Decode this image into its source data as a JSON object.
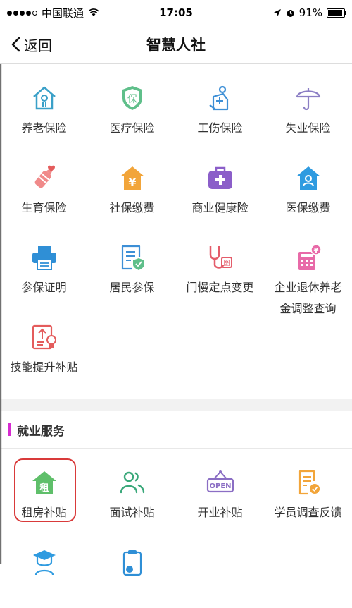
{
  "status_bar": {
    "carrier": "中国联通",
    "time": "17:05",
    "battery": "91%",
    "battery_level": 0.91
  },
  "nav": {
    "back_label": "返回",
    "title": "智慧人社"
  },
  "insurance_items": [
    {
      "label": "养老保险",
      "icon": "house-person-icon"
    },
    {
      "label": "医疗保险",
      "icon": "shield-bao-icon"
    },
    {
      "label": "工伤保险",
      "icon": "injured-person-icon"
    },
    {
      "label": "失业保险",
      "icon": "umbrella-icon"
    },
    {
      "label": "生育保险",
      "icon": "baby-bottle-icon"
    },
    {
      "label": "社保缴费",
      "icon": "yen-house-icon"
    },
    {
      "label": "商业健康险",
      "icon": "medical-kit-icon"
    },
    {
      "label": "医保缴费",
      "icon": "user-house-icon"
    },
    {
      "label": "参保证明",
      "icon": "printer-icon"
    },
    {
      "label": "居民参保",
      "icon": "document-shield-icon"
    },
    {
      "label": "门慢定点变更",
      "icon": "stethoscope-icon"
    },
    {
      "label": "企业退休养老金调整查询",
      "icon": "calculator-yen-icon"
    },
    {
      "label": "技能提升补贴",
      "icon": "certificate-icon"
    }
  ],
  "employment_section": {
    "title": "就业服务",
    "items": [
      {
        "label": "租房补贴",
        "icon": "rent-house-icon",
        "icon_text": "租"
      },
      {
        "label": "面试补贴",
        "icon": "people-icon"
      },
      {
        "label": "开业补贴",
        "icon": "open-sign-icon",
        "icon_text": "OPEN"
      },
      {
        "label": "学员调查反馈",
        "icon": "survey-document-icon"
      },
      {
        "label": "",
        "icon": "graduate-icon"
      },
      {
        "label": "",
        "icon": "clipboard-icon"
      }
    ]
  }
}
